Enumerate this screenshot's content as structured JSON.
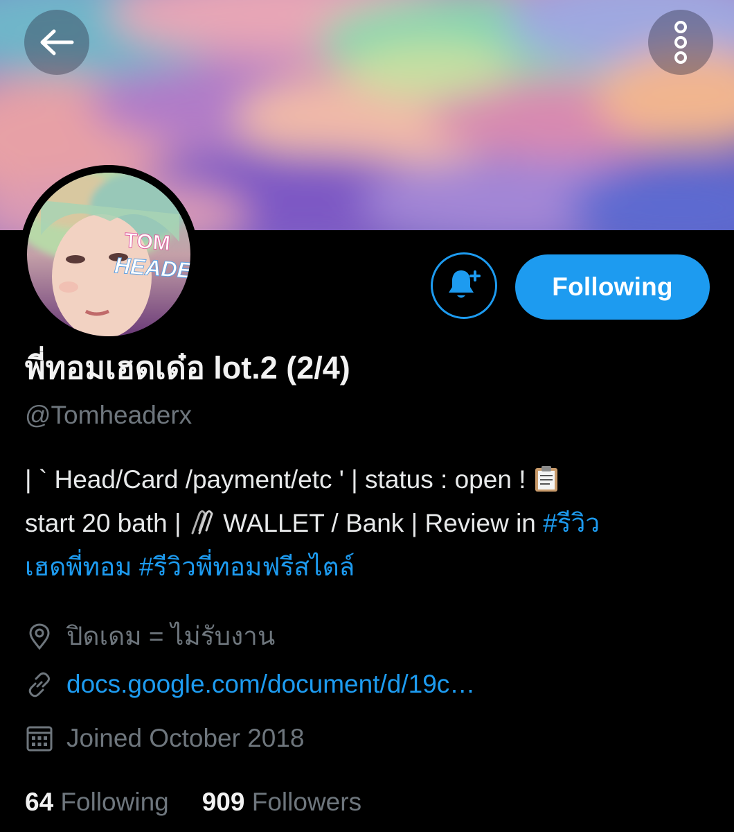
{
  "header": {
    "back_icon": "arrow-left-icon",
    "more_icon": "more-vertical-icon"
  },
  "avatar": {
    "logo_text_line1": "TOM",
    "logo_text_line2": "HEADE"
  },
  "actions": {
    "notify_icon": "bell-plus-icon",
    "following_label": "Following"
  },
  "profile": {
    "display_name": "พี่ทอมเฮดเด๋อ lot.2 (2/4)",
    "handle": "@Tomheaderx"
  },
  "bio": {
    "line1_text": "| ` Head/Card /payment/etc ' | status : open ! ",
    "line1_emoji": "clipboard-icon",
    "line2_text_a": "start 20 bath | ",
    "line2_emoji": "paperclips-icon",
    "line2_text_b": " WALLET / Bank  | Review in ",
    "line2_hashtag": "#รีวิว",
    "line3_hashtag_a": "เฮดพี่ทอม",
    "line3_space": " ",
    "line3_hashtag_b": "#รีวิวพี่ทอมฟรีสไตล์"
  },
  "meta": {
    "location": "ปิดเดม = ไม่รับงาน",
    "location_icon": "map-pin-icon",
    "link": "docs.google.com/document/d/19c…",
    "link_icon": "link-icon",
    "joined": "Joined October 2018",
    "joined_icon": "calendar-icon"
  },
  "stats": {
    "following_count": "64",
    "following_label": " Following",
    "followers_count": "909",
    "followers_label": " Followers"
  },
  "colors": {
    "accent": "#1d9bf0",
    "background": "#000000",
    "secondary_text": "#6e767d"
  }
}
